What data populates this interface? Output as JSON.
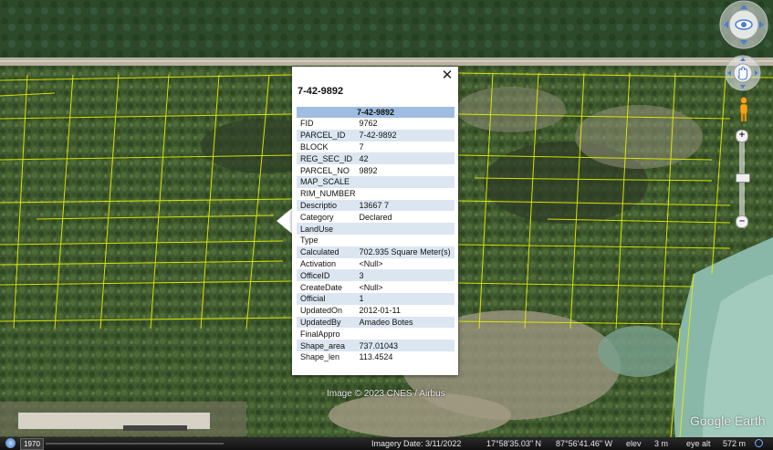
{
  "balloon": {
    "title": "7-42-9892",
    "close_label": "✕",
    "table_header": "7-42-9892",
    "rows": [
      {
        "key": "FID",
        "value": "9762"
      },
      {
        "key": "PARCEL_ID",
        "value": "7-42-9892"
      },
      {
        "key": "BLOCK",
        "value": "7"
      },
      {
        "key": "REG_SEC_ID",
        "value": "42"
      },
      {
        "key": "PARCEL_NO",
        "value": "9892"
      },
      {
        "key": "MAP_SCALE",
        "value": ""
      },
      {
        "key": "RIM_NUMBER",
        "value": ""
      },
      {
        "key": "Descriptio",
        "value": "13667 7"
      },
      {
        "key": "Category",
        "value": "Declared"
      },
      {
        "key": "LandUse",
        "value": ""
      },
      {
        "key": "Type",
        "value": ""
      },
      {
        "key": "Calculated",
        "value": "702.935 Square Meter(s)"
      },
      {
        "key": "Activation",
        "value": "<Null>"
      },
      {
        "key": "OfficeID",
        "value": "3"
      },
      {
        "key": "CreateDate",
        "value": "<Null>"
      },
      {
        "key": "Official",
        "value": "1"
      },
      {
        "key": "UpdatedOn",
        "value": "2012-01-11"
      },
      {
        "key": "UpdatedBy",
        "value": "Amadeo Botes"
      },
      {
        "key": "FinalAppro",
        "value": ""
      },
      {
        "key": "Shape_area",
        "value": "737.01043"
      },
      {
        "key": "Shape_len",
        "value": "113.4524"
      }
    ]
  },
  "map": {
    "image_credit": "Image © 2023 CNES / Airbus",
    "watermark": "Google Earth"
  },
  "status_bar": {
    "timeline_year": "1970",
    "imagery_date": "Imagery Date: 3/11/2022",
    "latitude": "17°58'35.03\" N",
    "longitude": "87°56'41.46\" W",
    "elev_label": "elev",
    "elev_value": "3 m",
    "eye_alt_label": "eye alt",
    "eye_alt_value": "572 m"
  },
  "colors": {
    "parcel_lines": "#e8f000",
    "table_header_bg": "#9fbde0",
    "table_alt_row_bg": "#dce6f1"
  },
  "icons": {
    "look": "look-around-icon",
    "move": "hand-move-icon",
    "streetview": "pegman-icon",
    "zoom_in": "plus-icon",
    "zoom_out": "minus-icon",
    "close": "close-icon"
  }
}
